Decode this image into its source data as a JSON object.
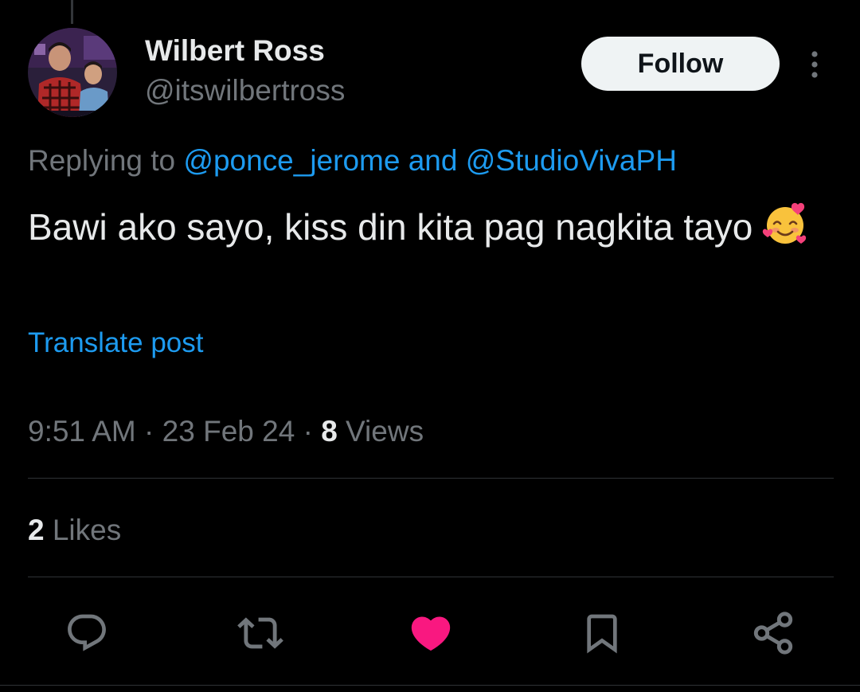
{
  "author": {
    "name": "Wilbert Ross",
    "handle": "@itswilbertross"
  },
  "follow_label": "Follow",
  "reply_context": {
    "prefix": "Replying to",
    "mention_1": "@ponce_jerome",
    "conjunction": "and",
    "mention_2": "@StudioVivaPH"
  },
  "tweet": {
    "text": "Bawi ako sayo, kiss din kita pag nagkita tayo",
    "emoji": "smiling-face-with-hearts"
  },
  "translate_label": "Translate post",
  "meta": {
    "time": "9:51 AM",
    "separator": "·",
    "date": "23 Feb 24",
    "views_count": "8",
    "views_label": "Views"
  },
  "engagement": {
    "likes_count": "2",
    "likes_label": "Likes"
  },
  "actions": [
    {
      "icon": "reply-icon"
    },
    {
      "icon": "retweet-icon"
    },
    {
      "icon": "like-icon",
      "active": true
    },
    {
      "icon": "bookmark-icon"
    },
    {
      "icon": "share-icon"
    }
  ],
  "colors": {
    "background": "#000000",
    "text_primary": "#e7e9ea",
    "text_secondary": "#71767b",
    "link": "#1d9bf0",
    "like_active": "#f91880",
    "follow_bg": "#eff3f4"
  }
}
